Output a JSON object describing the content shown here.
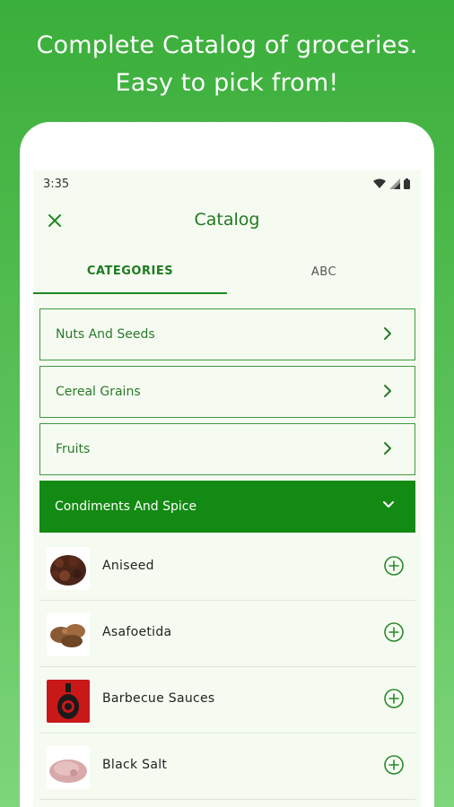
{
  "headline": {
    "line1": "Complete Catalog of groceries.",
    "line2": "Easy to pick from!"
  },
  "status_bar": {
    "time": "3:35"
  },
  "app_bar": {
    "title": "Catalog"
  },
  "tabs": [
    {
      "label": "CATEGORIES",
      "active": true
    },
    {
      "label": "ABC",
      "active": false
    }
  ],
  "categories": [
    {
      "label": "Nuts And Seeds",
      "icon": "chevron-right-icon"
    },
    {
      "label": "Cereal Grains",
      "icon": "chevron-right-icon"
    },
    {
      "label": "Fruits",
      "icon": "chevron-right-icon"
    }
  ],
  "expanded_category": {
    "label": "Condiments And Spice",
    "icon": "chevron-down-icon"
  },
  "items": [
    {
      "label": "Aniseed"
    },
    {
      "label": "Asafoetida"
    },
    {
      "label": "Barbecue Sauces"
    },
    {
      "label": "Black Salt"
    }
  ],
  "colors": {
    "accent": "#138a13",
    "background_gradient_top": "#3aae3a",
    "background_gradient_bottom": "#7ed67a"
  }
}
